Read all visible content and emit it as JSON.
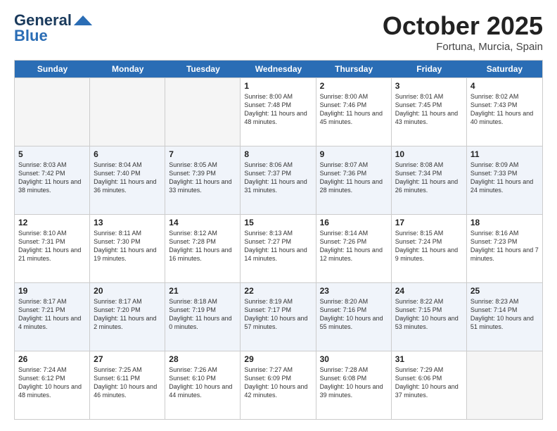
{
  "logo": {
    "line1": "General",
    "line2": "Blue"
  },
  "title": "October 2025",
  "location": "Fortuna, Murcia, Spain",
  "days_of_week": [
    "Sunday",
    "Monday",
    "Tuesday",
    "Wednesday",
    "Thursday",
    "Friday",
    "Saturday"
  ],
  "weeks": [
    [
      {
        "day": "",
        "empty": true
      },
      {
        "day": "",
        "empty": true
      },
      {
        "day": "",
        "empty": true
      },
      {
        "day": "1",
        "sunrise": "8:00 AM",
        "sunset": "7:48 PM",
        "daylight": "11 hours and 48 minutes."
      },
      {
        "day": "2",
        "sunrise": "8:00 AM",
        "sunset": "7:46 PM",
        "daylight": "11 hours and 45 minutes."
      },
      {
        "day": "3",
        "sunrise": "8:01 AM",
        "sunset": "7:45 PM",
        "daylight": "11 hours and 43 minutes."
      },
      {
        "day": "4",
        "sunrise": "8:02 AM",
        "sunset": "7:43 PM",
        "daylight": "11 hours and 40 minutes."
      }
    ],
    [
      {
        "day": "5",
        "sunrise": "8:03 AM",
        "sunset": "7:42 PM",
        "daylight": "11 hours and 38 minutes."
      },
      {
        "day": "6",
        "sunrise": "8:04 AM",
        "sunset": "7:40 PM",
        "daylight": "11 hours and 36 minutes."
      },
      {
        "day": "7",
        "sunrise": "8:05 AM",
        "sunset": "7:39 PM",
        "daylight": "11 hours and 33 minutes."
      },
      {
        "day": "8",
        "sunrise": "8:06 AM",
        "sunset": "7:37 PM",
        "daylight": "11 hours and 31 minutes."
      },
      {
        "day": "9",
        "sunrise": "8:07 AM",
        "sunset": "7:36 PM",
        "daylight": "11 hours and 28 minutes."
      },
      {
        "day": "10",
        "sunrise": "8:08 AM",
        "sunset": "7:34 PM",
        "daylight": "11 hours and 26 minutes."
      },
      {
        "day": "11",
        "sunrise": "8:09 AM",
        "sunset": "7:33 PM",
        "daylight": "11 hours and 24 minutes."
      }
    ],
    [
      {
        "day": "12",
        "sunrise": "8:10 AM",
        "sunset": "7:31 PM",
        "daylight": "11 hours and 21 minutes."
      },
      {
        "day": "13",
        "sunrise": "8:11 AM",
        "sunset": "7:30 PM",
        "daylight": "11 hours and 19 minutes."
      },
      {
        "day": "14",
        "sunrise": "8:12 AM",
        "sunset": "7:28 PM",
        "daylight": "11 hours and 16 minutes."
      },
      {
        "day": "15",
        "sunrise": "8:13 AM",
        "sunset": "7:27 PM",
        "daylight": "11 hours and 14 minutes."
      },
      {
        "day": "16",
        "sunrise": "8:14 AM",
        "sunset": "7:26 PM",
        "daylight": "11 hours and 12 minutes."
      },
      {
        "day": "17",
        "sunrise": "8:15 AM",
        "sunset": "7:24 PM",
        "daylight": "11 hours and 9 minutes."
      },
      {
        "day": "18",
        "sunrise": "8:16 AM",
        "sunset": "7:23 PM",
        "daylight": "11 hours and 7 minutes."
      }
    ],
    [
      {
        "day": "19",
        "sunrise": "8:17 AM",
        "sunset": "7:21 PM",
        "daylight": "11 hours and 4 minutes."
      },
      {
        "day": "20",
        "sunrise": "8:17 AM",
        "sunset": "7:20 PM",
        "daylight": "11 hours and 2 minutes."
      },
      {
        "day": "21",
        "sunrise": "8:18 AM",
        "sunset": "7:19 PM",
        "daylight": "11 hours and 0 minutes."
      },
      {
        "day": "22",
        "sunrise": "8:19 AM",
        "sunset": "7:17 PM",
        "daylight": "10 hours and 57 minutes."
      },
      {
        "day": "23",
        "sunrise": "8:20 AM",
        "sunset": "7:16 PM",
        "daylight": "10 hours and 55 minutes."
      },
      {
        "day": "24",
        "sunrise": "8:22 AM",
        "sunset": "7:15 PM",
        "daylight": "10 hours and 53 minutes."
      },
      {
        "day": "25",
        "sunrise": "8:23 AM",
        "sunset": "7:14 PM",
        "daylight": "10 hours and 51 minutes."
      }
    ],
    [
      {
        "day": "26",
        "sunrise": "7:24 AM",
        "sunset": "6:12 PM",
        "daylight": "10 hours and 48 minutes."
      },
      {
        "day": "27",
        "sunrise": "7:25 AM",
        "sunset": "6:11 PM",
        "daylight": "10 hours and 46 minutes."
      },
      {
        "day": "28",
        "sunrise": "7:26 AM",
        "sunset": "6:10 PM",
        "daylight": "10 hours and 44 minutes."
      },
      {
        "day": "29",
        "sunrise": "7:27 AM",
        "sunset": "6:09 PM",
        "daylight": "10 hours and 42 minutes."
      },
      {
        "day": "30",
        "sunrise": "7:28 AM",
        "sunset": "6:08 PM",
        "daylight": "10 hours and 39 minutes."
      },
      {
        "day": "31",
        "sunrise": "7:29 AM",
        "sunset": "6:06 PM",
        "daylight": "10 hours and 37 minutes."
      },
      {
        "day": "",
        "empty": true
      }
    ]
  ]
}
